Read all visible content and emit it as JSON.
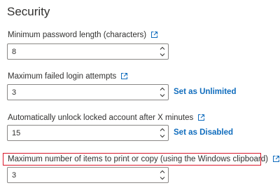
{
  "page": {
    "title": "Security"
  },
  "fields": {
    "min_password_length": {
      "label": "Minimum password length (characters)",
      "value": "8"
    },
    "max_failed_logins": {
      "label": "Maximum failed login attempts",
      "value": "3",
      "action": "Set as Unlimited"
    },
    "auto_unlock_minutes": {
      "label": "Automatically unlock locked account after X minutes",
      "value": "15",
      "action": "Set as Disabled"
    },
    "max_print_copy_items": {
      "label": "Maximum number of items to print or copy (using the Windows clipboard)",
      "value": "3"
    }
  },
  "icons": {
    "external_link": "open-in-new-window-icon",
    "spin_up": "chevron-up-icon",
    "spin_down": "chevron-down-icon"
  },
  "colors": {
    "link": "#0f6cbd",
    "highlight_border": "#d9182b",
    "input_border": "#8a8886"
  }
}
